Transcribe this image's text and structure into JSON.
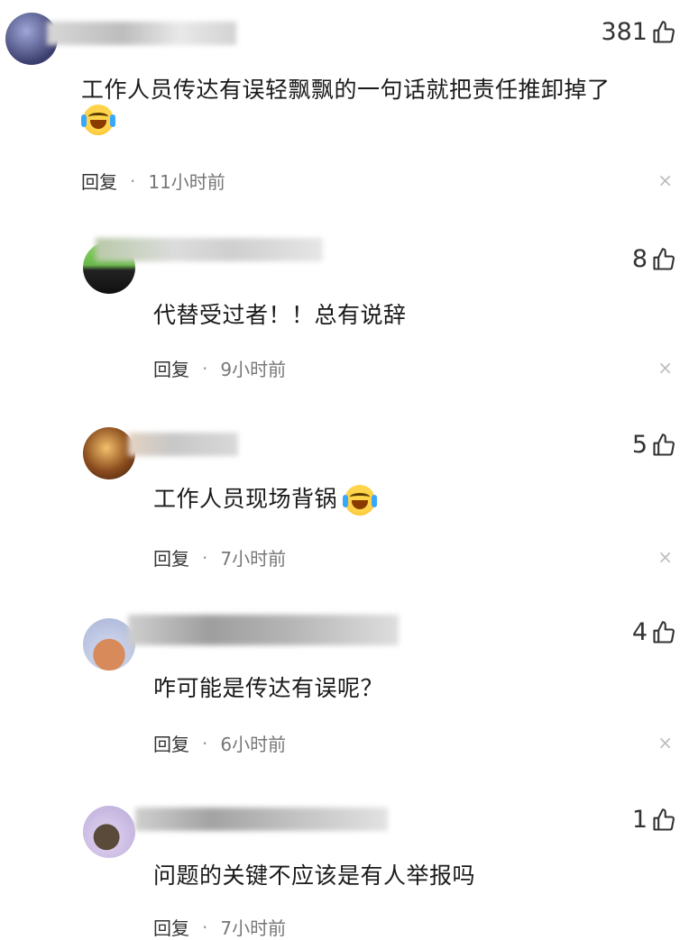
{
  "colors": {
    "reply_text": "#333333",
    "time_text": "#777777",
    "close": "#bdbdbd"
  },
  "comments": [
    {
      "likes": "381",
      "text": "工作人员传达有误轻飘飘的一句话就把责任推卸掉了",
      "reply": "回复",
      "dot": "·",
      "time": "11小时前",
      "close": "×"
    },
    {
      "likes": "8",
      "text": "代替受过者！！总有说辞",
      "reply": "回复",
      "dot": "·",
      "time": "9小时前",
      "close": "×"
    },
    {
      "likes": "5",
      "text": "工作人员现场背锅",
      "reply": "回复",
      "dot": "·",
      "time": "7小时前",
      "close": "×"
    },
    {
      "likes": "4",
      "text": "咋可能是传达有误呢？",
      "reply": "回复",
      "dot": "·",
      "time": "6小时前",
      "close": "×"
    },
    {
      "likes": "1",
      "text": "问题的关键不应该是有人举报吗",
      "reply": "回复",
      "dot": "·",
      "time": "7小时前",
      "close": ""
    }
  ]
}
